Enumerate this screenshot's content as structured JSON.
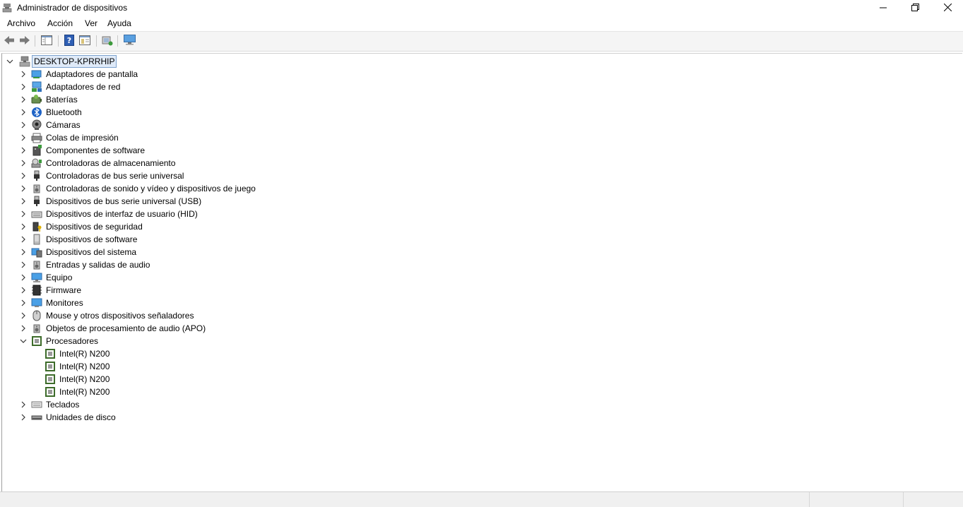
{
  "window": {
    "title": "Administrador de dispositivos",
    "controls": {
      "minimize": "minimize-icon",
      "restore": "restore-icon",
      "close": "close-icon"
    }
  },
  "menu": [
    "Archivo",
    "Acción",
    "Ver",
    "Ayuda"
  ],
  "toolbar": {
    "buttons": [
      "back-arrow-icon",
      "forward-arrow-icon",
      "show-hide-console-tree-icon",
      "help-icon",
      "properties-icon",
      "scan-hardware-changes-icon",
      "computer-monitor-icon"
    ]
  },
  "tree": {
    "root": "DESKTOP-KPRRHIP",
    "categories": [
      {
        "label": "Adaptadores de pantalla",
        "icon": "display-adapter-icon"
      },
      {
        "label": "Adaptadores de red",
        "icon": "network-adapter-icon"
      },
      {
        "label": "Baterías",
        "icon": "battery-icon"
      },
      {
        "label": "Bluetooth",
        "icon": "bluetooth-icon"
      },
      {
        "label": "Cámaras",
        "icon": "camera-icon"
      },
      {
        "label": "Colas de impresión",
        "icon": "printer-icon"
      },
      {
        "label": "Componentes de software",
        "icon": "software-component-icon"
      },
      {
        "label": "Controladoras de almacenamiento",
        "icon": "storage-controller-icon"
      },
      {
        "label": "Controladoras de bus serie universal",
        "icon": "usb-plug-icon"
      },
      {
        "label": "Controladoras de sonido y vídeo y dispositivos de juego",
        "icon": "speaker-icon"
      },
      {
        "label": "Dispositivos de bus serie universal (USB)",
        "icon": "usb-plug-icon"
      },
      {
        "label": "Dispositivos de interfaz de usuario (HID)",
        "icon": "hid-keyboard-icon"
      },
      {
        "label": "Dispositivos de seguridad",
        "icon": "security-key-icon"
      },
      {
        "label": "Dispositivos de software",
        "icon": "software-device-icon"
      },
      {
        "label": "Dispositivos del sistema",
        "icon": "system-device-icon"
      },
      {
        "label": "Entradas y salidas de audio",
        "icon": "speaker-icon"
      },
      {
        "label": "Equipo",
        "icon": "computer-icon"
      },
      {
        "label": "Firmware",
        "icon": "firmware-chip-icon"
      },
      {
        "label": "Monitores",
        "icon": "monitor-icon"
      },
      {
        "label": "Mouse y otros dispositivos señaladores",
        "icon": "mouse-icon"
      },
      {
        "label": "Objetos de procesamiento de audio (APO)",
        "icon": "speaker-icon"
      },
      {
        "label": "Procesadores",
        "icon": "processor-icon",
        "expanded": true,
        "children": [
          "Intel(R) N200",
          "Intel(R) N200",
          "Intel(R) N200",
          "Intel(R) N200"
        ]
      },
      {
        "label": "Teclados",
        "icon": "keyboard-icon"
      },
      {
        "label": "Unidades de disco",
        "icon": "disk-drive-icon"
      }
    ]
  }
}
